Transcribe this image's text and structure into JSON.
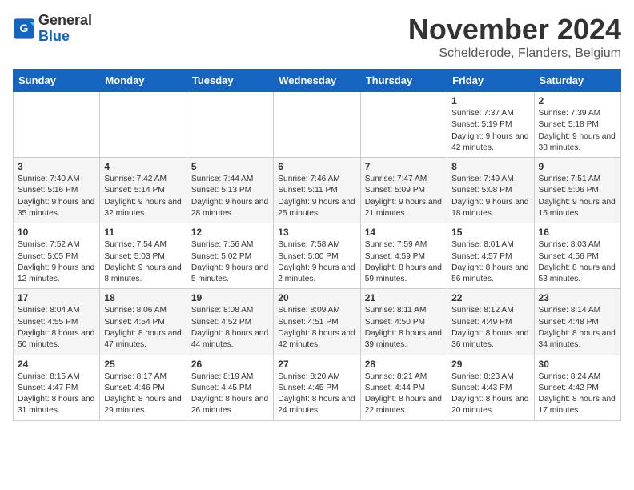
{
  "logo": {
    "general": "General",
    "blue": "Blue"
  },
  "title": "November 2024",
  "location": "Schelderode, Flanders, Belgium",
  "weekdays": [
    "Sunday",
    "Monday",
    "Tuesday",
    "Wednesday",
    "Thursday",
    "Friday",
    "Saturday"
  ],
  "weeks": [
    [
      null,
      null,
      null,
      null,
      null,
      {
        "day": "1",
        "sunrise": "Sunrise: 7:37 AM",
        "sunset": "Sunset: 5:19 PM",
        "daylight": "Daylight: 9 hours and 42 minutes."
      },
      {
        "day": "2",
        "sunrise": "Sunrise: 7:39 AM",
        "sunset": "Sunset: 5:18 PM",
        "daylight": "Daylight: 9 hours and 38 minutes."
      }
    ],
    [
      {
        "day": "3",
        "sunrise": "Sunrise: 7:40 AM",
        "sunset": "Sunset: 5:16 PM",
        "daylight": "Daylight: 9 hours and 35 minutes."
      },
      {
        "day": "4",
        "sunrise": "Sunrise: 7:42 AM",
        "sunset": "Sunset: 5:14 PM",
        "daylight": "Daylight: 9 hours and 32 minutes."
      },
      {
        "day": "5",
        "sunrise": "Sunrise: 7:44 AM",
        "sunset": "Sunset: 5:13 PM",
        "daylight": "Daylight: 9 hours and 28 minutes."
      },
      {
        "day": "6",
        "sunrise": "Sunrise: 7:46 AM",
        "sunset": "Sunset: 5:11 PM",
        "daylight": "Daylight: 9 hours and 25 minutes."
      },
      {
        "day": "7",
        "sunrise": "Sunrise: 7:47 AM",
        "sunset": "Sunset: 5:09 PM",
        "daylight": "Daylight: 9 hours and 21 minutes."
      },
      {
        "day": "8",
        "sunrise": "Sunrise: 7:49 AM",
        "sunset": "Sunset: 5:08 PM",
        "daylight": "Daylight: 9 hours and 18 minutes."
      },
      {
        "day": "9",
        "sunrise": "Sunrise: 7:51 AM",
        "sunset": "Sunset: 5:06 PM",
        "daylight": "Daylight: 9 hours and 15 minutes."
      }
    ],
    [
      {
        "day": "10",
        "sunrise": "Sunrise: 7:52 AM",
        "sunset": "Sunset: 5:05 PM",
        "daylight": "Daylight: 9 hours and 12 minutes."
      },
      {
        "day": "11",
        "sunrise": "Sunrise: 7:54 AM",
        "sunset": "Sunset: 5:03 PM",
        "daylight": "Daylight: 9 hours and 8 minutes."
      },
      {
        "day": "12",
        "sunrise": "Sunrise: 7:56 AM",
        "sunset": "Sunset: 5:02 PM",
        "daylight": "Daylight: 9 hours and 5 minutes."
      },
      {
        "day": "13",
        "sunrise": "Sunrise: 7:58 AM",
        "sunset": "Sunset: 5:00 PM",
        "daylight": "Daylight: 9 hours and 2 minutes."
      },
      {
        "day": "14",
        "sunrise": "Sunrise: 7:59 AM",
        "sunset": "Sunset: 4:59 PM",
        "daylight": "Daylight: 8 hours and 59 minutes."
      },
      {
        "day": "15",
        "sunrise": "Sunrise: 8:01 AM",
        "sunset": "Sunset: 4:57 PM",
        "daylight": "Daylight: 8 hours and 56 minutes."
      },
      {
        "day": "16",
        "sunrise": "Sunrise: 8:03 AM",
        "sunset": "Sunset: 4:56 PM",
        "daylight": "Daylight: 8 hours and 53 minutes."
      }
    ],
    [
      {
        "day": "17",
        "sunrise": "Sunrise: 8:04 AM",
        "sunset": "Sunset: 4:55 PM",
        "daylight": "Daylight: 8 hours and 50 minutes."
      },
      {
        "day": "18",
        "sunrise": "Sunrise: 8:06 AM",
        "sunset": "Sunset: 4:54 PM",
        "daylight": "Daylight: 8 hours and 47 minutes."
      },
      {
        "day": "19",
        "sunrise": "Sunrise: 8:08 AM",
        "sunset": "Sunset: 4:52 PM",
        "daylight": "Daylight: 8 hours and 44 minutes."
      },
      {
        "day": "20",
        "sunrise": "Sunrise: 8:09 AM",
        "sunset": "Sunset: 4:51 PM",
        "daylight": "Daylight: 8 hours and 42 minutes."
      },
      {
        "day": "21",
        "sunrise": "Sunrise: 8:11 AM",
        "sunset": "Sunset: 4:50 PM",
        "daylight": "Daylight: 8 hours and 39 minutes."
      },
      {
        "day": "22",
        "sunrise": "Sunrise: 8:12 AM",
        "sunset": "Sunset: 4:49 PM",
        "daylight": "Daylight: 8 hours and 36 minutes."
      },
      {
        "day": "23",
        "sunrise": "Sunrise: 8:14 AM",
        "sunset": "Sunset: 4:48 PM",
        "daylight": "Daylight: 8 hours and 34 minutes."
      }
    ],
    [
      {
        "day": "24",
        "sunrise": "Sunrise: 8:15 AM",
        "sunset": "Sunset: 4:47 PM",
        "daylight": "Daylight: 8 hours and 31 minutes."
      },
      {
        "day": "25",
        "sunrise": "Sunrise: 8:17 AM",
        "sunset": "Sunset: 4:46 PM",
        "daylight": "Daylight: 8 hours and 29 minutes."
      },
      {
        "day": "26",
        "sunrise": "Sunrise: 8:19 AM",
        "sunset": "Sunset: 4:45 PM",
        "daylight": "Daylight: 8 hours and 26 minutes."
      },
      {
        "day": "27",
        "sunrise": "Sunrise: 8:20 AM",
        "sunset": "Sunset: 4:45 PM",
        "daylight": "Daylight: 8 hours and 24 minutes."
      },
      {
        "day": "28",
        "sunrise": "Sunrise: 8:21 AM",
        "sunset": "Sunset: 4:44 PM",
        "daylight": "Daylight: 8 hours and 22 minutes."
      },
      {
        "day": "29",
        "sunrise": "Sunrise: 8:23 AM",
        "sunset": "Sunset: 4:43 PM",
        "daylight": "Daylight: 8 hours and 20 minutes."
      },
      {
        "day": "30",
        "sunrise": "Sunrise: 8:24 AM",
        "sunset": "Sunset: 4:42 PM",
        "daylight": "Daylight: 8 hours and 17 minutes."
      }
    ]
  ]
}
